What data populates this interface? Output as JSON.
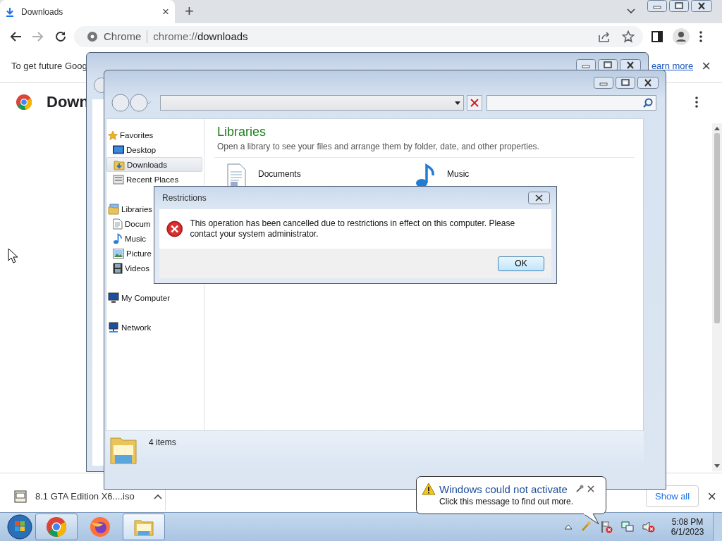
{
  "browser": {
    "tab": {
      "title": "Downloads",
      "close": "×",
      "selected": true
    },
    "new_tab": "+",
    "omnibox": {
      "site": "Chrome",
      "url_scheme": "chrome://",
      "url_path": "downloads"
    },
    "infobar": {
      "text": "To get future Goog",
      "link": "earn more",
      "close": "×"
    },
    "page": {
      "title": "Down"
    },
    "download_shelf": {
      "file": "8.1 GTA Edition X6....iso",
      "show_all": "Show all",
      "close": "×"
    }
  },
  "explorer": {
    "nav_pane": [
      {
        "label": "Favorites",
        "kind": "star",
        "selected": false,
        "children": [
          {
            "label": "Desktop",
            "kind": "desktop",
            "selected": false
          },
          {
            "label": "Downloads",
            "kind": "downloads",
            "selected": true
          },
          {
            "label": "Recent Places",
            "kind": "recent",
            "selected": false
          }
        ]
      },
      {
        "label": "Libraries",
        "kind": "library",
        "selected": false,
        "children": [
          {
            "label": "Docum",
            "kind": "document",
            "selected": false
          },
          {
            "label": "Music",
            "kind": "music",
            "selected": false
          },
          {
            "label": "Picture",
            "kind": "picture",
            "selected": false
          },
          {
            "label": "Videos",
            "kind": "video",
            "selected": false
          }
        ]
      },
      {
        "label": "My Computer",
        "kind": "computer",
        "selected": false
      },
      {
        "label": "Network",
        "kind": "network",
        "selected": false
      }
    ],
    "heading": "Libraries",
    "subtitle": "Open a library to see your files and arrange them by folder, date, and other properties.",
    "libraries": [
      {
        "name": "Documents",
        "kind": "document"
      },
      {
        "name": "Music",
        "kind": "music"
      }
    ],
    "details": "4 items"
  },
  "dialog": {
    "title": "Restrictions",
    "message": "This operation has been cancelled due to restrictions in effect on this computer. Please contact your system administrator.",
    "button": "OK"
  },
  "notification": {
    "title": "Windows could not activate",
    "text": "Click this message to find out more."
  },
  "taskbar": {
    "apps": [
      {
        "kind": "chrome",
        "running": true,
        "selected": false
      },
      {
        "kind": "firefox",
        "running": false,
        "selected": false
      },
      {
        "kind": "explorer",
        "running": true,
        "selected": true
      }
    ],
    "clock": {
      "time": "5:08 PM",
      "date": "6/1/2023"
    }
  }
}
